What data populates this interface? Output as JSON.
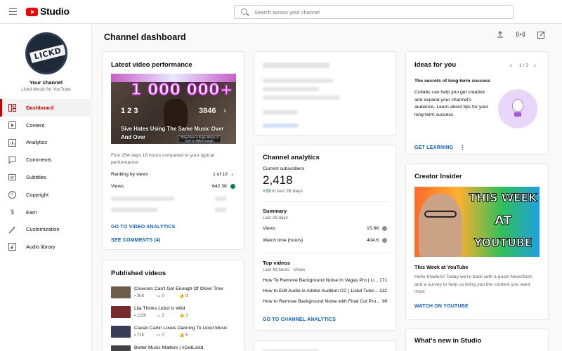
{
  "app": {
    "title": "Studio"
  },
  "search": {
    "placeholder": "Search across your channel"
  },
  "sidebar": {
    "avatar_text": "LICKD",
    "your_channel": "Your channel",
    "channel_name": "Lickd Music for YouTube",
    "items": [
      {
        "label": "Dashboard",
        "icon": "dashboard-icon",
        "active": true
      },
      {
        "label": "Content",
        "icon": "content-icon"
      },
      {
        "label": "Analytics",
        "icon": "analytics-icon"
      },
      {
        "label": "Comments",
        "icon": "comments-icon"
      },
      {
        "label": "Subtitles",
        "icon": "subtitles-icon"
      },
      {
        "label": "Copyright",
        "icon": "copyright-icon"
      },
      {
        "label": "Earn",
        "icon": "earn-icon"
      },
      {
        "label": "Customization",
        "icon": "customization-icon"
      },
      {
        "label": "Audio library",
        "icon": "audio-library-icon"
      }
    ]
  },
  "page": {
    "title": "Channel dashboard"
  },
  "latest": {
    "title": "Latest video performance",
    "thumb_big": "1 000 000+",
    "thumb_nums": "1  2  3",
    "thumb_nums2": "3846",
    "thumb_bubble": "They have a huge library of over a million songs.",
    "video_title": "Sive Hates Using The Same Music Over And Over",
    "compare_text": "First 254 days 18 hours compared to your typical performance:",
    "ranking_label": "Ranking by views",
    "ranking_value": "1 of 10",
    "views_label": "Views",
    "views_value": "642.3K",
    "link_analytics": "GO TO VIDEO ANALYTICS",
    "link_comments": "SEE COMMENTS (4)"
  },
  "published": {
    "title": "Published videos",
    "videos": [
      {
        "title": "Cinecom Can't Get Enough Of Oliver Tree",
        "views": "36K",
        "comments": "0",
        "likes": "9"
      },
      {
        "title": "Lila Thinks Lickd Is Wild",
        "views": "113K",
        "comments": "2",
        "likes": "3"
      },
      {
        "title": "Ciaran Carlin Loves Dancing To Lickd Music",
        "views": "72K",
        "comments": "0",
        "likes": "5"
      },
      {
        "title": "Better Music Matters | #GetLickd",
        "views": "",
        "comments": "",
        "likes": ""
      }
    ]
  },
  "analytics": {
    "title": "Channel analytics",
    "subs_label": "Current subscribers",
    "subs_value": "2,418",
    "subs_delta": "+72",
    "subs_delta_suffix": "in last 28 days",
    "summary_title": "Summary",
    "summary_sub": "Last 28 days",
    "views_label": "Views",
    "views_value": "15.8K",
    "watch_label": "Watch time (hours)",
    "watch_value": "404.6",
    "top_title": "Top videos",
    "top_sub": "Last 48 hours · Views",
    "top_videos": [
      {
        "title": "How To Remove Background Noise In Vegas Pro | Li...",
        "value": "171"
      },
      {
        "title": "How to Edit Audio in Adobe Audition CC | Lickd Tutor...",
        "value": "112"
      },
      {
        "title": "How to Remove Background Noise with Final Cut Pro...",
        "value": "90"
      }
    ],
    "link": "GO TO CHANNEL ANALYTICS"
  },
  "ideas": {
    "title": "Ideas for you",
    "pager": "1 / 2",
    "subtitle": "The secrets of long-term success",
    "body": "Collabs can help you get creative and expand your channel's audience. Learn about tips for your long-term success",
    "link": "GET LEARNING"
  },
  "insider": {
    "title": "Creator Insider",
    "thumb_l1": "THIS WEEK",
    "thumb_l2": "AT",
    "thumb_l3": "YOUTUBE",
    "video_title": "This Week at YouTube",
    "body": "Hello Insiders! Today we're back with a quick Newsflash and a survey to help us bring you the content you want most",
    "link": "WATCH ON YOUTUBE"
  },
  "whatsnew": {
    "title": "What's new in Studio"
  },
  "colors": {
    "brand": "#ff0000",
    "accent": "#065fd4",
    "active": "#cc0000",
    "positive": "#0b8043"
  }
}
